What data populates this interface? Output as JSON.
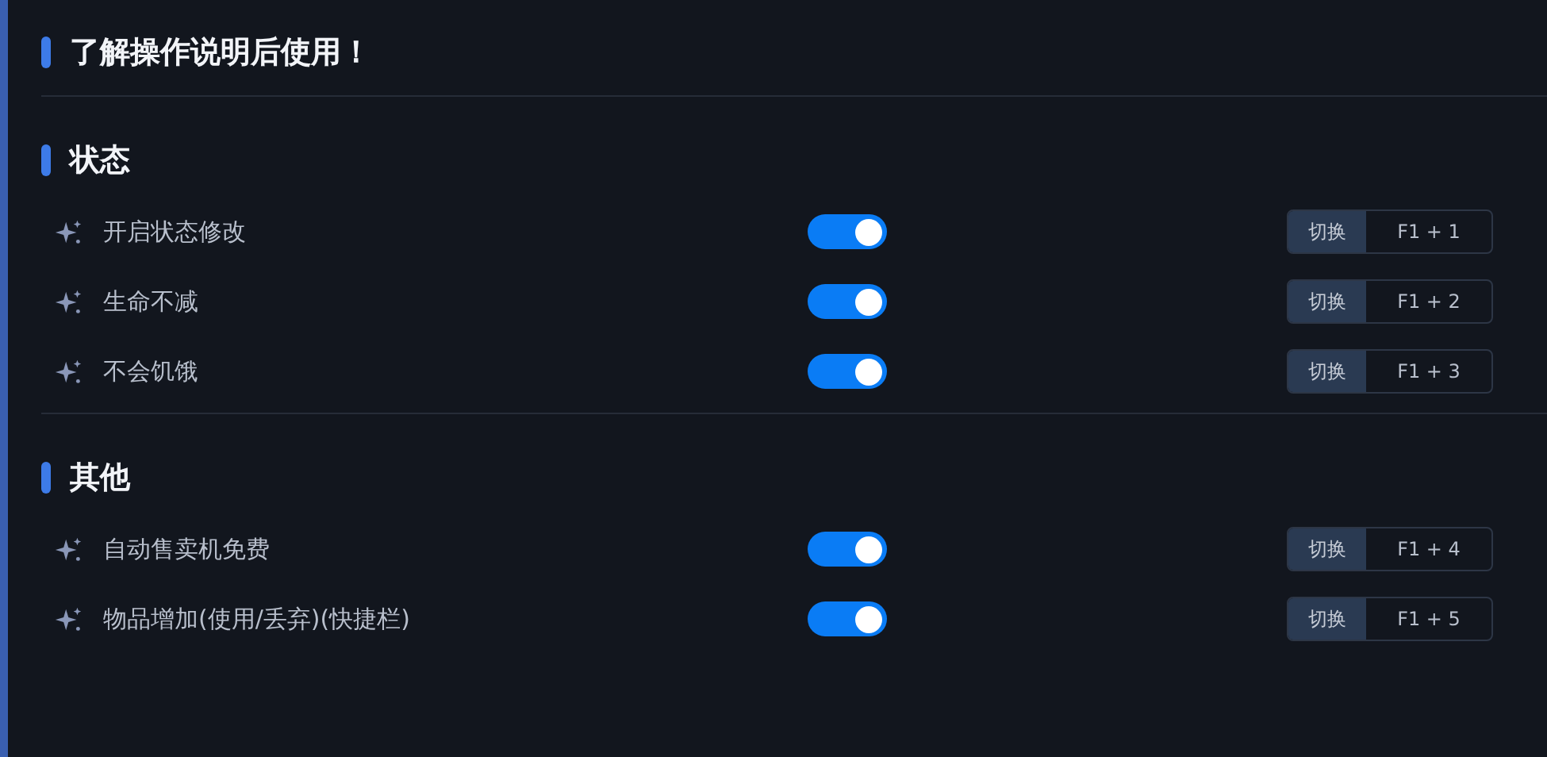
{
  "notice": "了解操作说明后使用！",
  "sections": [
    {
      "title": "状态",
      "options": [
        {
          "label": "开启状态修改",
          "on": true,
          "action": "切换",
          "hotkey": "F1 + 1"
        },
        {
          "label": "生命不减",
          "on": true,
          "action": "切换",
          "hotkey": "F1 + 2"
        },
        {
          "label": "不会饥饿",
          "on": true,
          "action": "切换",
          "hotkey": "F1 + 3"
        }
      ]
    },
    {
      "title": "其他",
      "options": [
        {
          "label": "自动售卖机免费",
          "on": true,
          "action": "切换",
          "hotkey": "F1 + 4"
        },
        {
          "label": "物品增加(使用/丢弃)(快捷栏)",
          "on": true,
          "action": "切换",
          "hotkey": "F1 + 5"
        }
      ]
    }
  ]
}
